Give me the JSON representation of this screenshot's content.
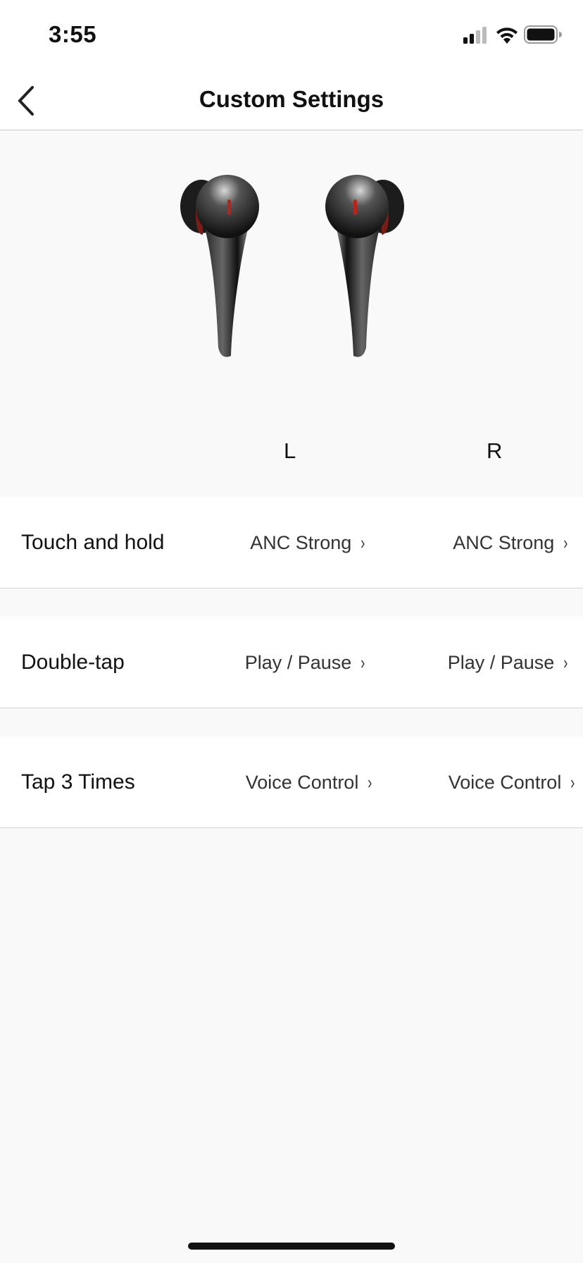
{
  "status_bar": {
    "time": "3:55",
    "icons": [
      "cellular-signal-icon",
      "wifi-icon",
      "battery-icon"
    ]
  },
  "nav": {
    "title": "Custom Settings",
    "back_icon": "chevron-left-icon"
  },
  "hero": {
    "left_label": "L",
    "right_label": "R",
    "image": "earbuds-image"
  },
  "rows": [
    {
      "label": "Touch and hold",
      "left": "ANC Strong",
      "right": "ANC Strong"
    },
    {
      "label": "Double-tap",
      "left": "Play / Pause",
      "right": "Play / Pause"
    },
    {
      "label": "Tap 3 Times",
      "left": "Voice Control",
      "right": "Voice Control"
    }
  ],
  "chevron": "›",
  "colors": {
    "background": "#f9f9f9",
    "row": "#ffffff",
    "accent_red": "#b3261e"
  }
}
